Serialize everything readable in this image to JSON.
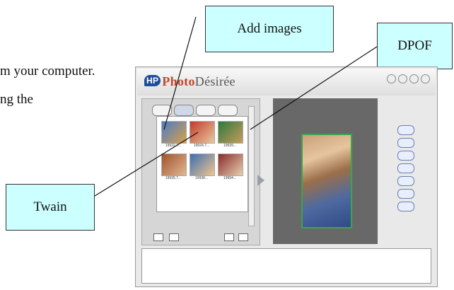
{
  "document": {
    "line1": "m your computer.",
    "line2": "ng the"
  },
  "callouts": {
    "add_images": "Add images",
    "dpof": "DPOF",
    "twain": "Twain"
  },
  "app": {
    "logo_hp": "HP",
    "logo_photo": "Photo",
    "logo_desiree": "Désirée",
    "thumbnails": [
      {
        "caption": "19922.7..."
      },
      {
        "caption": "19924.7..."
      },
      {
        "caption": "19939..."
      },
      {
        "caption": "19935.7..."
      },
      {
        "caption": "19938..."
      },
      {
        "caption": "19994..."
      }
    ]
  },
  "colors": {
    "callout_fill": "#ccffff",
    "photo_border": "#3aa64a",
    "accent_orange": "#f08a1a"
  }
}
